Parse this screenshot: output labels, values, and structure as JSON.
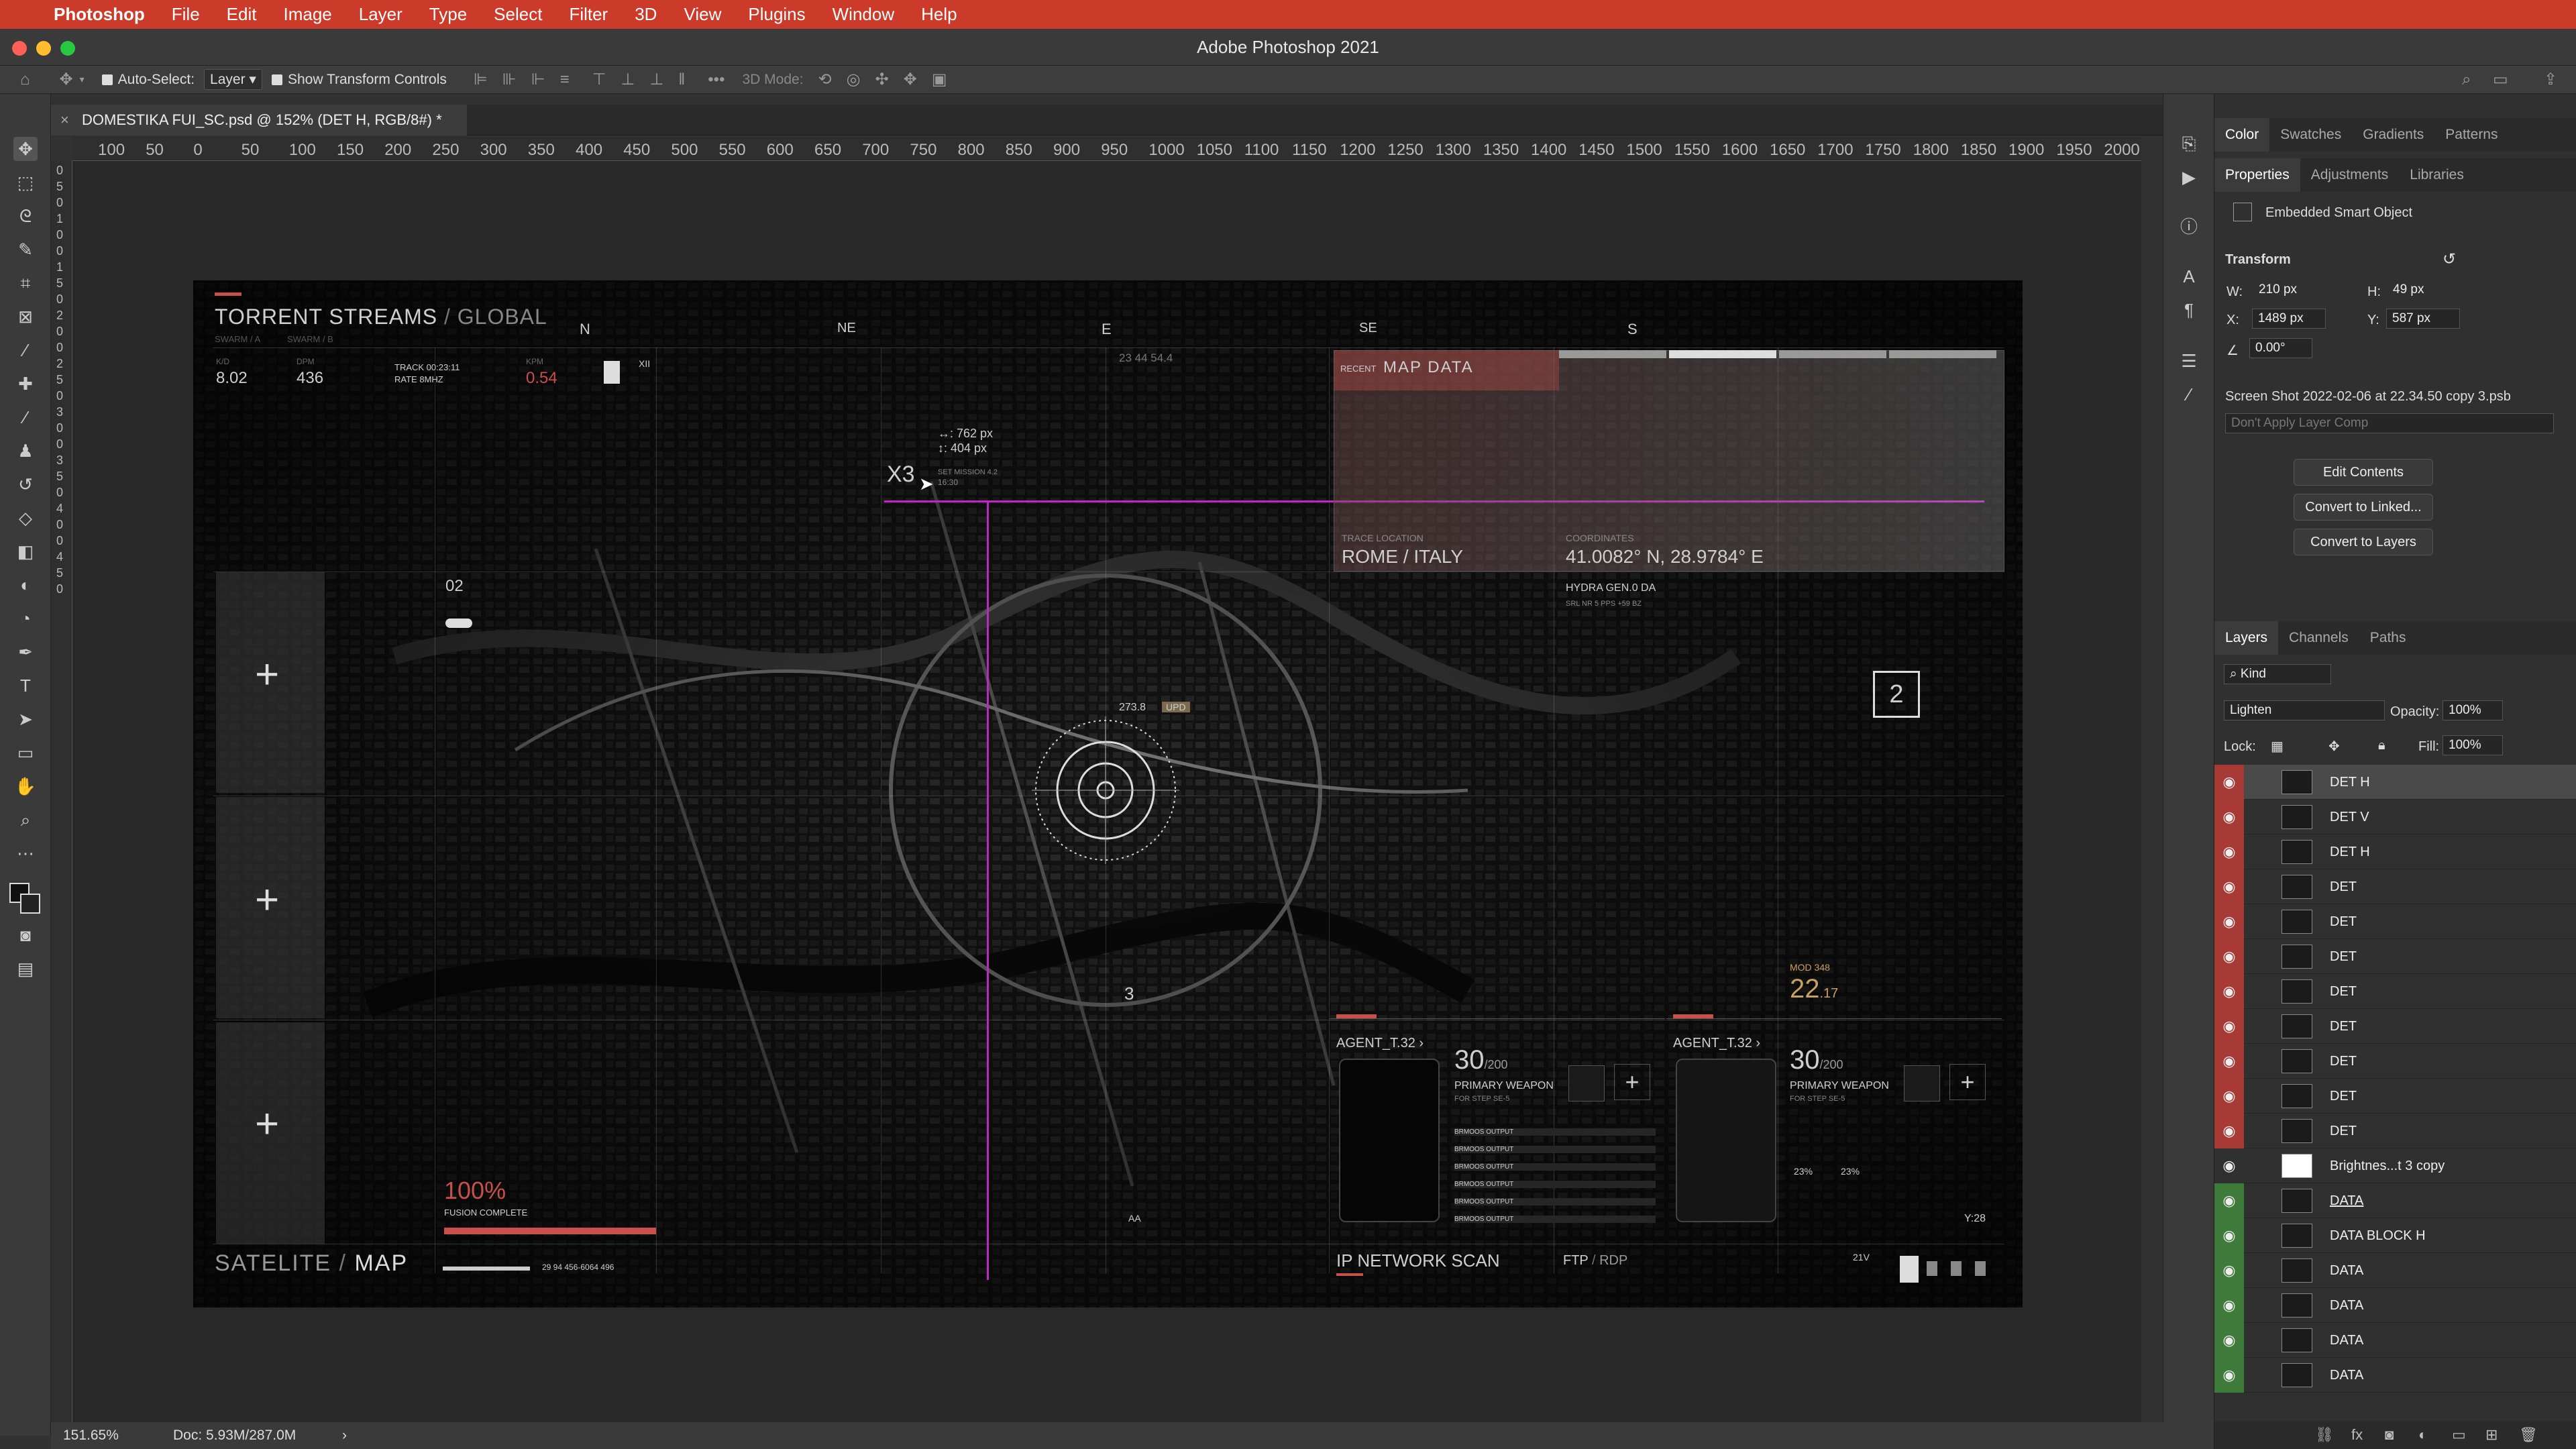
{
  "menubar": {
    "app_name": "Photoshop",
    "items": [
      "File",
      "Edit",
      "Image",
      "Layer",
      "Type",
      "Select",
      "Filter",
      "3D",
      "View",
      "Plugins",
      "Window",
      "Help"
    ]
  },
  "window": {
    "title": "Adobe Photoshop 2021"
  },
  "options_bar": {
    "auto_select_label": "Auto-Select:",
    "auto_select_value": "Layer",
    "show_transform_label": "Show Transform Controls",
    "mode_3d_label": "3D Mode:"
  },
  "document": {
    "tab_title": "DOMESTIKA FUI_SC.psd @ 152% (DET H, RGB/8#) *"
  },
  "ruler": {
    "h_ticks": [
      "100",
      "50",
      "0",
      "50",
      "100",
      "150",
      "200",
      "250",
      "300",
      "350",
      "400",
      "450",
      "500",
      "550",
      "600",
      "650",
      "700",
      "750",
      "800",
      "850",
      "900",
      "950",
      "1000",
      "1050",
      "1100",
      "1150",
      "1200",
      "1250",
      "1300",
      "1350",
      "1400",
      "1450",
      "1500",
      "1550",
      "1600",
      "1650",
      "1700",
      "1750",
      "1800",
      "1850",
      "1900",
      "1950",
      "2000"
    ],
    "v_ticks": [
      "0",
      "5",
      "0",
      "1",
      "0",
      "0",
      "1",
      "5",
      "0",
      "2",
      "0",
      "0",
      "2",
      "5",
      "0",
      "3",
      "0",
      "0",
      "3",
      "5",
      "0",
      "4",
      "0",
      "0",
      "4",
      "5",
      "0"
    ]
  },
  "status": {
    "zoom": "151.65%",
    "doc": "Doc: 5.93M/287.0M",
    "arrow": "›"
  },
  "artwork": {
    "title_main": "TORRENT STREAMS",
    "title_sep": " / ",
    "title_sub": "GLOBAL",
    "swarm_a": "SWARM / A",
    "swarm_b": "SWARM / B",
    "compass": [
      "N",
      "NE",
      "E",
      "SE",
      "S"
    ],
    "stats": [
      {
        "label": "K/D",
        "value": "8.02"
      },
      {
        "label": "DPM",
        "value": "436"
      },
      {
        "label": "KPM",
        "value": "0.54"
      }
    ],
    "track_label": "TRACK 00:23:11",
    "rate_label": "RATE 8MHZ",
    "xii": "XII",
    "coord_readout": "23 44 54.4",
    "measure_w": "↔: 762 px",
    "measure_h": "↕: 404 px",
    "x3": "X3",
    "set_mission": "SET MISSION 4.2",
    "mission_time": "16:30",
    "map_data_recent": "RECENT",
    "map_data": "MAP DATA",
    "trace_location_label": "TRACE LOCATION",
    "trace_location": "ROME / ITALY",
    "coordinates_label": "COORDINATES",
    "coordinates": "41.0082° N, 28.9784° E",
    "hydra": "HYDRA GEN.0 DA",
    "hydra_sub": "SRL NR 5  PPS  +59 BZ",
    "panel_num_02": "02",
    "box_num": "2",
    "map_num": "3",
    "target_label": "273.8",
    "target_tag": "UPD",
    "mod_label": "MOD 348",
    "mod_value": "22",
    "mod_decimal": ".17",
    "progress_pct": "100%",
    "fusion": "FUSION COMPLETE",
    "footer_left_a": "SATELITE",
    "footer_left_sep": " / ",
    "footer_left_b": "MAP",
    "footer_nums": "29  94  456-6064  496",
    "agents": [
      {
        "name": "AGENT_T.32 ›",
        "ammo": "30",
        "ammo_max": "/200",
        "weapon": "PRIMARY WEAPON",
        "step": "FOR STEP SE-5"
      },
      {
        "name": "AGENT_T.32 ›",
        "ammo": "30",
        "ammo_max": "/200",
        "weapon": "PRIMARY WEAPON",
        "step": "FOR STEP SE-5"
      }
    ],
    "output_row": "BRMOOS OUTPUT",
    "gauge_1": "23%",
    "gauge_2": "23%",
    "wave_time": "Y:28",
    "ip_scan": "IP NETWORK SCAN",
    "ftp_a": "FTP",
    "ftp_sep": " / ",
    "ftp_b": "RDP",
    "twenty_one": "21V",
    "aa": "AA"
  },
  "panels": {
    "top_tabs": [
      "Color",
      "Swatches",
      "Gradients",
      "Patterns"
    ],
    "prop_tabs": [
      "Properties",
      "Adjustments",
      "Libraries"
    ],
    "embedded_label": "Embedded Smart Object",
    "transform_label": "Transform",
    "w_label": "W:",
    "w_value": "210 px",
    "h_label": "H:",
    "h_value": "49 px",
    "x_label": "X:",
    "x_value": "1489 px",
    "y_label": "Y:",
    "y_value": "587 px",
    "angle_value": "0.00°",
    "linked_file": "Screen Shot 2022-02-06 at 22.34.50 copy 3.psb",
    "layer_comp": "Don't Apply Layer Comp",
    "edit_contents": "Edit Contents",
    "convert_linked": "Convert to Linked...",
    "convert_layers": "Convert to Layers",
    "layer_tabs": [
      "Layers",
      "Channels",
      "Paths"
    ],
    "kind": "Kind",
    "blend_mode": "Lighten",
    "opacity_label": "Opacity:",
    "opacity_value": "100%",
    "lock_label": "Lock:",
    "fill_label": "Fill:",
    "fill_value": "100%",
    "layers": [
      {
        "name": "DET H",
        "eye": "red"
      },
      {
        "name": "DET V",
        "eye": "red"
      },
      {
        "name": "DET H",
        "eye": "red"
      },
      {
        "name": "DET",
        "eye": "red"
      },
      {
        "name": "DET",
        "eye": "red"
      },
      {
        "name": "DET",
        "eye": "red"
      },
      {
        "name": "DET",
        "eye": "red"
      },
      {
        "name": "DET",
        "eye": "red"
      },
      {
        "name": "DET",
        "eye": "red"
      },
      {
        "name": "DET",
        "eye": "red"
      },
      {
        "name": "DET",
        "eye": "red"
      },
      {
        "name": "Brightnes...t 3 copy",
        "eye": "none"
      },
      {
        "name": "DATA",
        "eye": "green"
      },
      {
        "name": "DATA BLOCK H",
        "eye": "green"
      },
      {
        "name": "DATA",
        "eye": "green"
      },
      {
        "name": "DATA",
        "eye": "green"
      },
      {
        "name": "DATA",
        "eye": "green"
      },
      {
        "name": "DATA",
        "eye": "green"
      }
    ]
  },
  "colors": {
    "menubar": "#cc3b2a",
    "eye_red": "#a83a36",
    "eye_green": "#3e7a3a",
    "guide": "#c026c6",
    "accent_red": "#c8504a"
  }
}
